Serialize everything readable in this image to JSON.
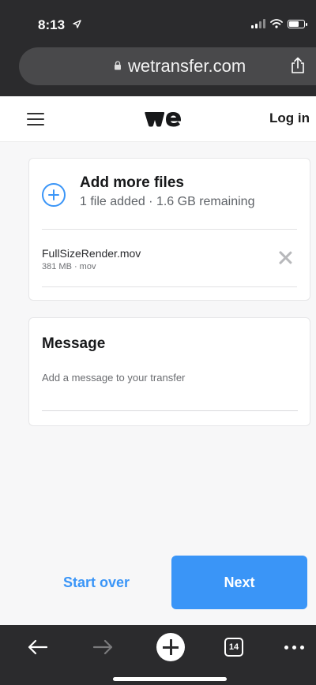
{
  "status_bar": {
    "time": "8:13"
  },
  "browser": {
    "url": "wetransfer.com",
    "tabs_count": "14"
  },
  "header": {
    "logo_text": "we",
    "login_label": "Log in"
  },
  "files_card": {
    "add_title": "Add more files",
    "add_subtitle": "1 file added · 1.6 GB remaining",
    "files": [
      {
        "name": "FullSizeRender.mov",
        "meta": "381 MB · mov"
      }
    ]
  },
  "message_card": {
    "title": "Message",
    "placeholder": "Add a message to your transfer"
  },
  "actions": {
    "start_over_label": "Start over",
    "next_label": "Next"
  },
  "colors": {
    "accent": "#3a95f7",
    "chrome": "#2b2b2d"
  }
}
